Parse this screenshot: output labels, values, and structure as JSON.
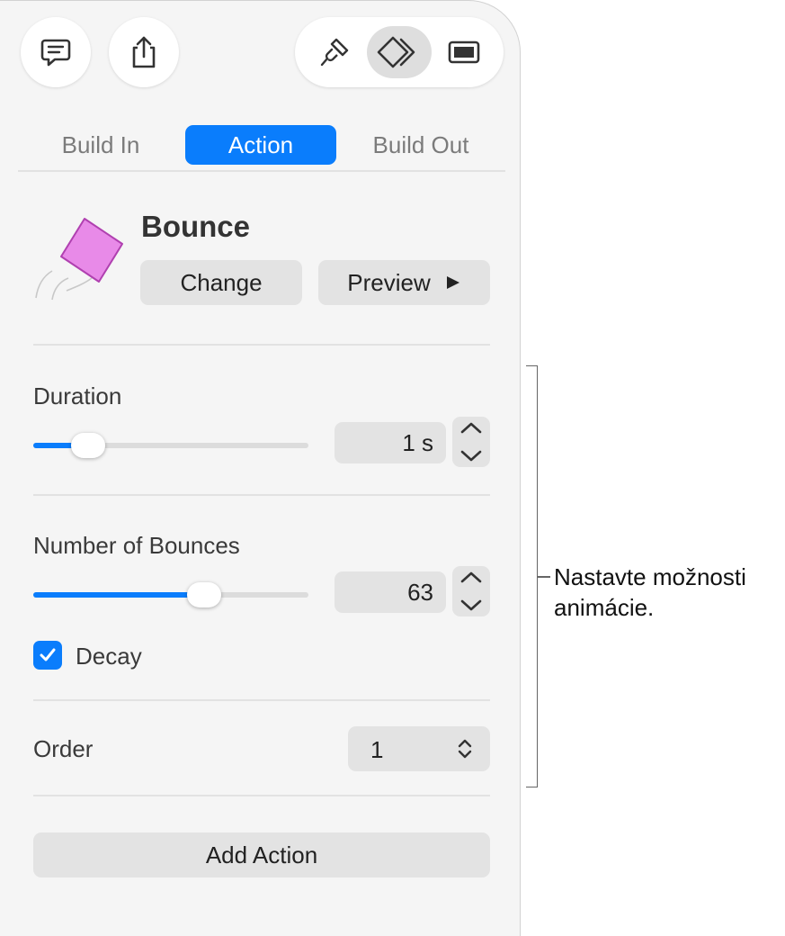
{
  "toolbar": {
    "comment_icon": "speech-bubble-icon",
    "share_icon": "share-icon",
    "format_icon": "paintbrush-icon",
    "animate_icon": "animate-diamond-icon",
    "document_icon": "document-rectangle-icon",
    "active_segment": "animate"
  },
  "tabs": [
    {
      "label": "Build In",
      "active": false
    },
    {
      "label": "Action",
      "active": true
    },
    {
      "label": "Build Out",
      "active": false
    }
  ],
  "effect": {
    "name": "Bounce",
    "thumbnail_icon": "bounce-diamond-icon",
    "change_label": "Change",
    "preview_label": "Preview",
    "preview_icon": "play-triangle-icon"
  },
  "duration": {
    "label": "Duration",
    "value": "1 s",
    "slider_fraction": 0.2
  },
  "bounces": {
    "label": "Number of Bounces",
    "value": "63",
    "slider_fraction": 0.62
  },
  "decay": {
    "label": "Decay",
    "checked": true
  },
  "order": {
    "label": "Order",
    "value": "1"
  },
  "add_action_label": "Add Action",
  "callout": {
    "text": "Nastavte možnosti animácie."
  },
  "colors": {
    "accent": "#0a7dfc",
    "panel_bg": "#f5f5f5",
    "control_bg": "#e3e3e3",
    "thumbnail_fill": "#e88ae8"
  }
}
